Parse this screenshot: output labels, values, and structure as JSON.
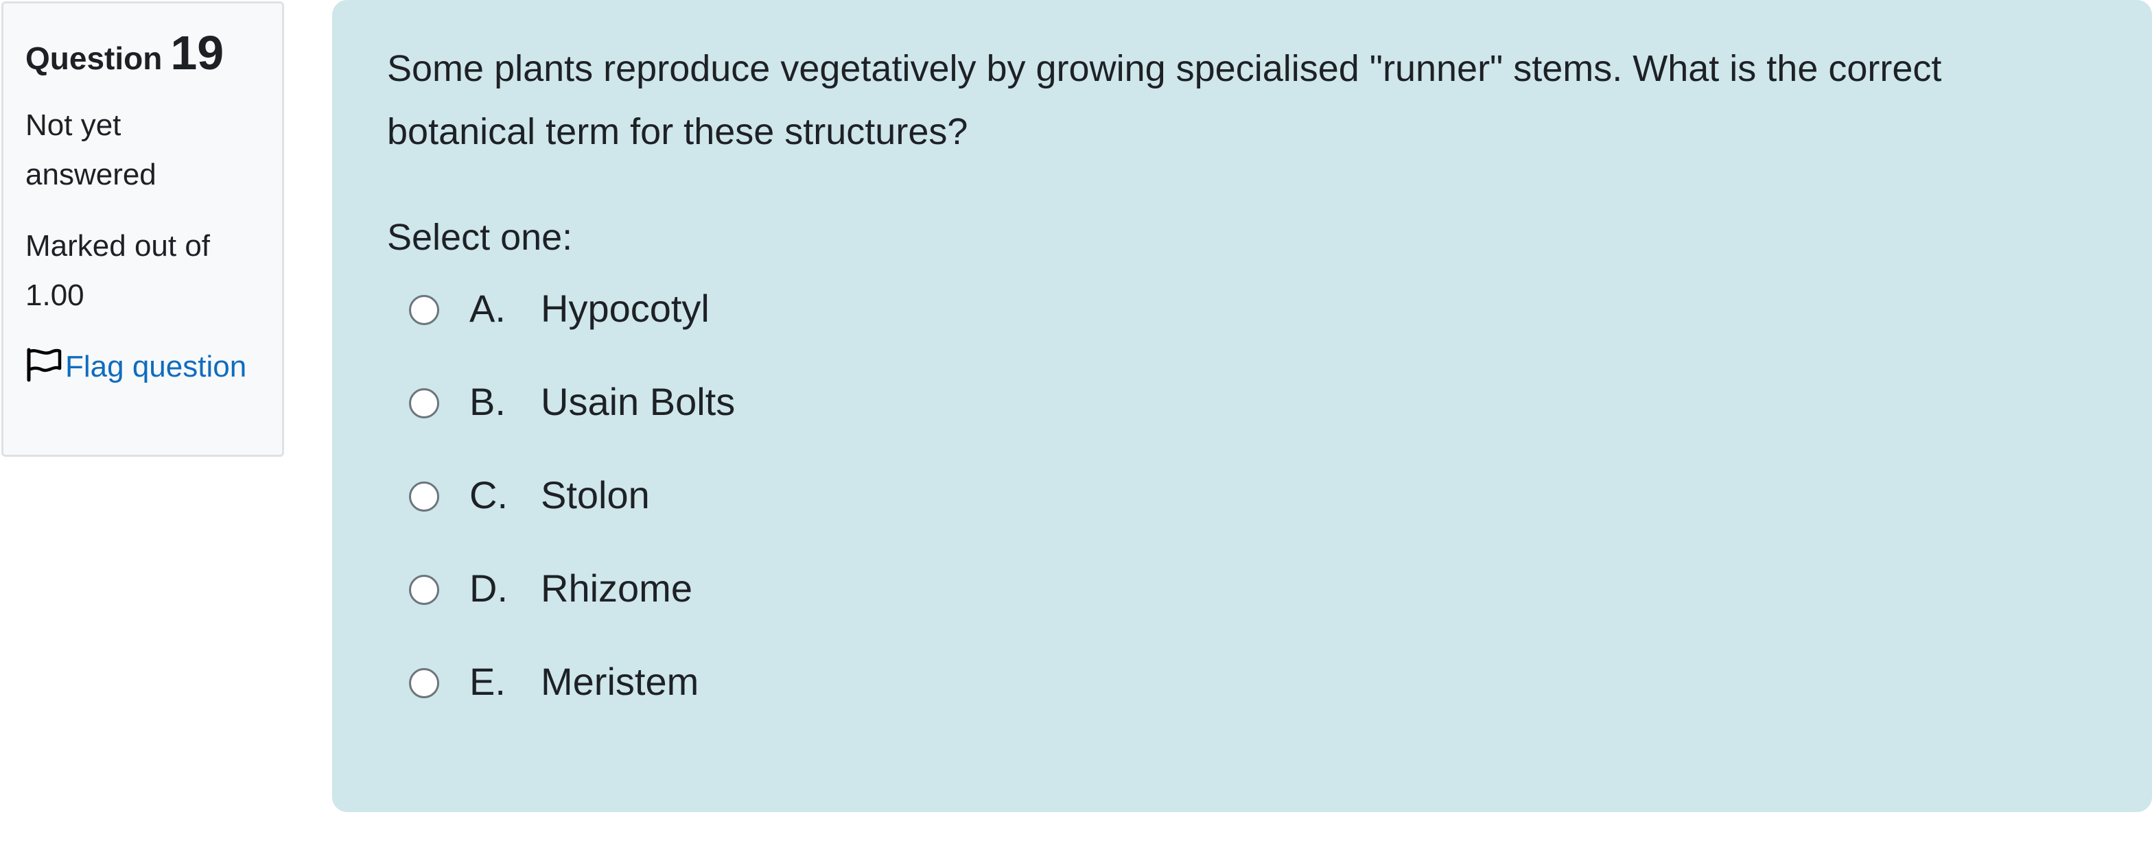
{
  "info": {
    "question_label": "Question",
    "question_number": "19",
    "state": "Not yet answered",
    "grade": "Marked out of 1.00",
    "flag_label": "Flag question",
    "flag_icon": "flag-icon"
  },
  "question": {
    "text": "Some plants reproduce vegetatively by growing specialised \"runner\" stems. What is the correct botanical term for these structures?",
    "prompt": "Select one:",
    "answers": [
      {
        "letter": "A.",
        "text": "Hypocotyl"
      },
      {
        "letter": "B.",
        "text": "Usain Bolts"
      },
      {
        "letter": "C.",
        "text": "Stolon"
      },
      {
        "letter": "D.",
        "text": "Rhizome"
      },
      {
        "letter": "E.",
        "text": "Meristem"
      }
    ]
  },
  "colors": {
    "content_background": "#cfe6ea",
    "info_background": "#f8f9fa",
    "link": "#0f6cbf"
  }
}
